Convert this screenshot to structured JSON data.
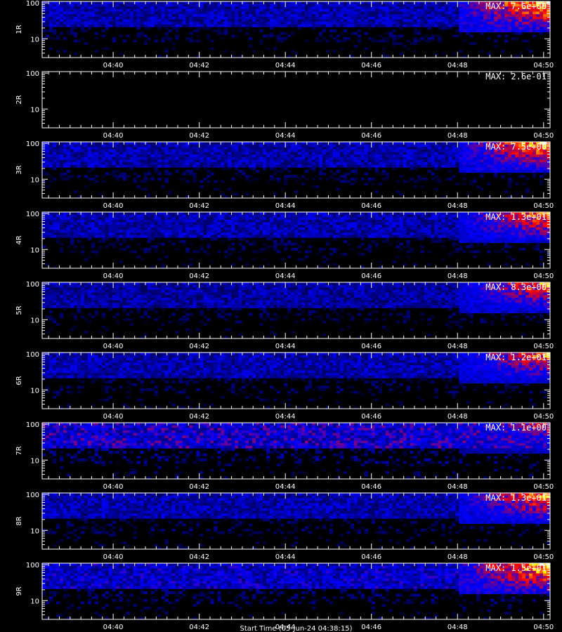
{
  "chart_data": {
    "type": "heatmap",
    "y_scale": "log",
    "ylim": [
      3,
      110
    ],
    "y_ticks": [
      10,
      100
    ],
    "x_ticks": [
      "04:40",
      "04:42",
      "04:44",
      "04:46",
      "04:48",
      "04:50"
    ],
    "x_range_minutes": [
      38.35,
      50.15
    ],
    "bottom_xlabel": "Start Time (05-Jun-24 04:38:15)",
    "colormap": [
      "#000000",
      "#0000ff",
      "#ff0000",
      "#ffff00",
      "#ffffff"
    ],
    "panels": [
      {
        "label": "1R",
        "max_text": "MAX: 7.6e+00",
        "max": 7.6,
        "background": 0.3,
        "hot": 1.0
      },
      {
        "label": "2R",
        "max_text": "MAX: 2.6e-01",
        "max": 0.26,
        "background": 0.0,
        "hot": 0.0
      },
      {
        "label": "3R",
        "max_text": "MAX: 7.5e+00",
        "max": 7.5,
        "background": 0.3,
        "hot": 0.95
      },
      {
        "label": "4R",
        "max_text": "MAX: 1.3e+01",
        "max": 13,
        "background": 0.3,
        "hot": 0.9
      },
      {
        "label": "5R",
        "max_text": "MAX: 8.3e+00",
        "max": 8.3,
        "background": 0.28,
        "hot": 0.85
      },
      {
        "label": "6R",
        "max_text": "MAX: 1.2e+01",
        "max": 12,
        "background": 0.3,
        "hot": 0.85
      },
      {
        "label": "7R",
        "max_text": "MAX: 1.1e+00",
        "max": 1.1,
        "background": 0.4,
        "hot": 0.7
      },
      {
        "label": "8R",
        "max_text": "MAX: 1.3e+01",
        "max": 13,
        "background": 0.3,
        "hot": 0.9
      },
      {
        "label": "9R",
        "max_text": "MAX: 1.5e+01",
        "max": 15,
        "background": 0.35,
        "hot": 1.0
      }
    ]
  }
}
